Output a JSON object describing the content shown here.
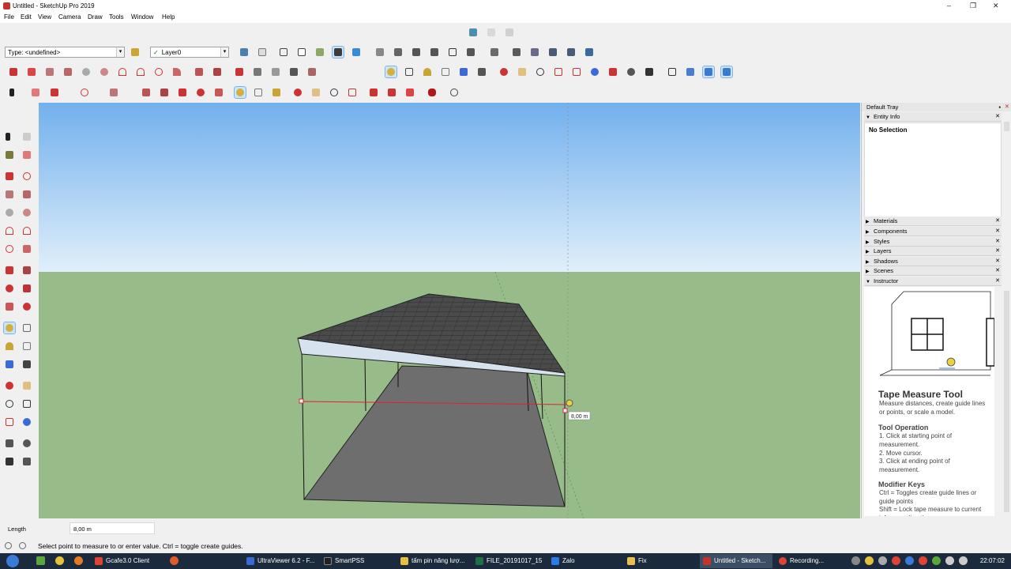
{
  "window": {
    "title": "Untitled - SketchUp Pro 2019",
    "minimize": "–",
    "restore": "❐",
    "close": "✕"
  },
  "menu": [
    "File",
    "Edit",
    "View",
    "Camera",
    "Draw",
    "Tools",
    "Window",
    "Help"
  ],
  "toolbar": {
    "type_combo": "Type: <undefined>",
    "layer_combo": "Layer0",
    "layer_check": "✓",
    "dropdown_arrow": "▾"
  },
  "tray": {
    "title": "Default Tray",
    "entity_info": "Entity Info",
    "no_selection": "No Selection",
    "panels": [
      "Materials",
      "Components",
      "Styles",
      "Layers",
      "Shadows",
      "Scenes",
      "Instructor"
    ]
  },
  "instructor": {
    "tool_title": "Tape Measure Tool",
    "description": "Measure distances, create guide lines or points, or scale a model.",
    "operation_title": "Tool Operation",
    "steps": [
      "1. Click at starting point of measurement.",
      "2. Move cursor.",
      "3. Click at ending point of measurement."
    ],
    "modifier_title": "Modifier Keys",
    "modifiers": [
      "Ctrl = Toggles create guide lines or guide points",
      "Shift = Lock tape measure to current inference direction"
    ]
  },
  "viewport": {
    "measure_tooltip": "8,00 m"
  },
  "measurements": {
    "label": "Length",
    "value": "8,00 m"
  },
  "status": {
    "text": "Select point to measure to or enter value.  Ctrl = toggle create guides."
  },
  "taskbar": {
    "items": [
      "Gcafe3.0 Client",
      "UltraViewer 6.2 - F...",
      "SmartPSS",
      "tấm pin năng lượ...",
      "FILE_20191017_15...",
      "Zalo",
      "Fix",
      "Untitled - Sketch...",
      "Recording..."
    ],
    "clock": "22:07:02"
  },
  "colors": {
    "accent_blue": "#cce4f7",
    "sketchup_red": "#c4342d",
    "ground": "#98bb8a",
    "sky_top": "#72b0ed"
  }
}
